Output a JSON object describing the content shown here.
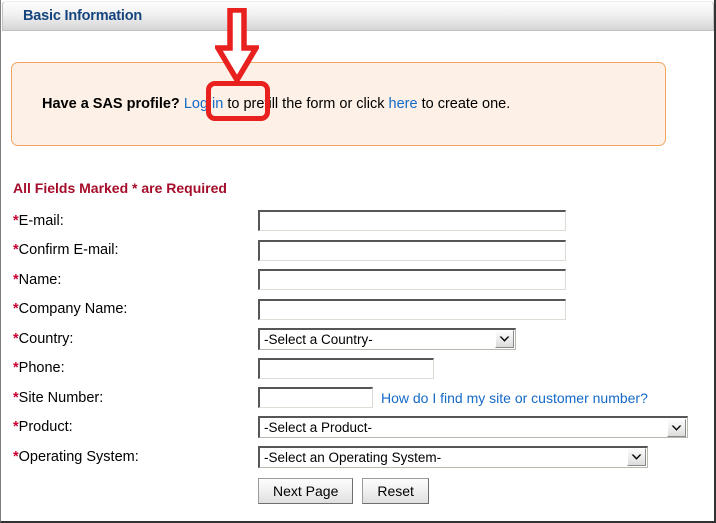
{
  "section": {
    "title": "Basic Information"
  },
  "notice": {
    "lead": "Have a SAS profile?",
    "login_link": "Log in",
    "middle": " to prefill the form or click ",
    "create_link": "here",
    "tail": " to create one."
  },
  "annotation": {
    "arrow_color": "#e8201e",
    "highlight_color": "#e8201e",
    "highlight_target": "Log in"
  },
  "form": {
    "required_note": "All Fields Marked * are Required",
    "required_marker": "*",
    "fields": [
      {
        "label": "E-mail:",
        "type": "text",
        "value": "",
        "width": "wide"
      },
      {
        "label": "Confirm E-mail:",
        "type": "text",
        "value": "",
        "width": "wide"
      },
      {
        "label": "Name:",
        "type": "text",
        "value": "",
        "width": "wide"
      },
      {
        "label": "Company Name:",
        "type": "text",
        "value": "",
        "width": "wide"
      },
      {
        "label": "Country:",
        "type": "select",
        "value": "-Select a Country-"
      },
      {
        "label": "Phone:",
        "type": "text",
        "value": "",
        "width": "mid"
      },
      {
        "label": "Site Number:",
        "type": "text",
        "value": "",
        "width": "small"
      },
      {
        "label": "Product:",
        "type": "select",
        "value": "-Select a Product-"
      },
      {
        "label": "Operating System:",
        "type": "select",
        "value": "-Select an Operating System-"
      }
    ],
    "site_number_help": "How do I find my site or customer number?"
  },
  "buttons": {
    "next": "Next Page",
    "reset": "Reset"
  },
  "colors": {
    "header_title": "#16447e",
    "notice_bg": "#fdf0e6",
    "notice_border": "#f0a561",
    "link": "#1569c7",
    "required_note": "#a50d2a",
    "asterisk": "#cc0033",
    "annotation": "#e8201e"
  }
}
